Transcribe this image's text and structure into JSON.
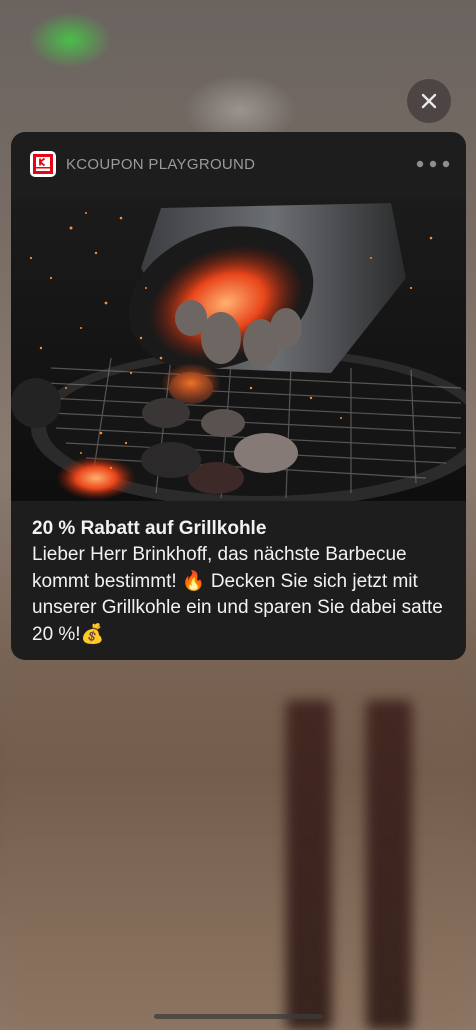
{
  "notification": {
    "app_name": "KCOUPON PLAYGROUND",
    "app_icon": "kaufland-logo-icon",
    "title": "20 % Rabatt auf Grillkohle",
    "message": "Lieber Herr Brinkhoff, das nächste Barbecue kommt bestimmt! 🔥 Decken Sie sich jetzt mit unserer Grillkohle ein und sparen Sie dabei satte 20 %!💰",
    "image": "charcoal-chimney-grill-photo",
    "more_icon": "ellipsis-icon"
  },
  "overlay": {
    "close_icon": "close-icon"
  },
  "system": {
    "home_indicator": "home-indicator"
  },
  "colors": {
    "card_background": "#1e1d1e",
    "text_primary": "#f2f2f2",
    "text_secondary": "#9a9a9c",
    "brand_red": "#e30613"
  }
}
